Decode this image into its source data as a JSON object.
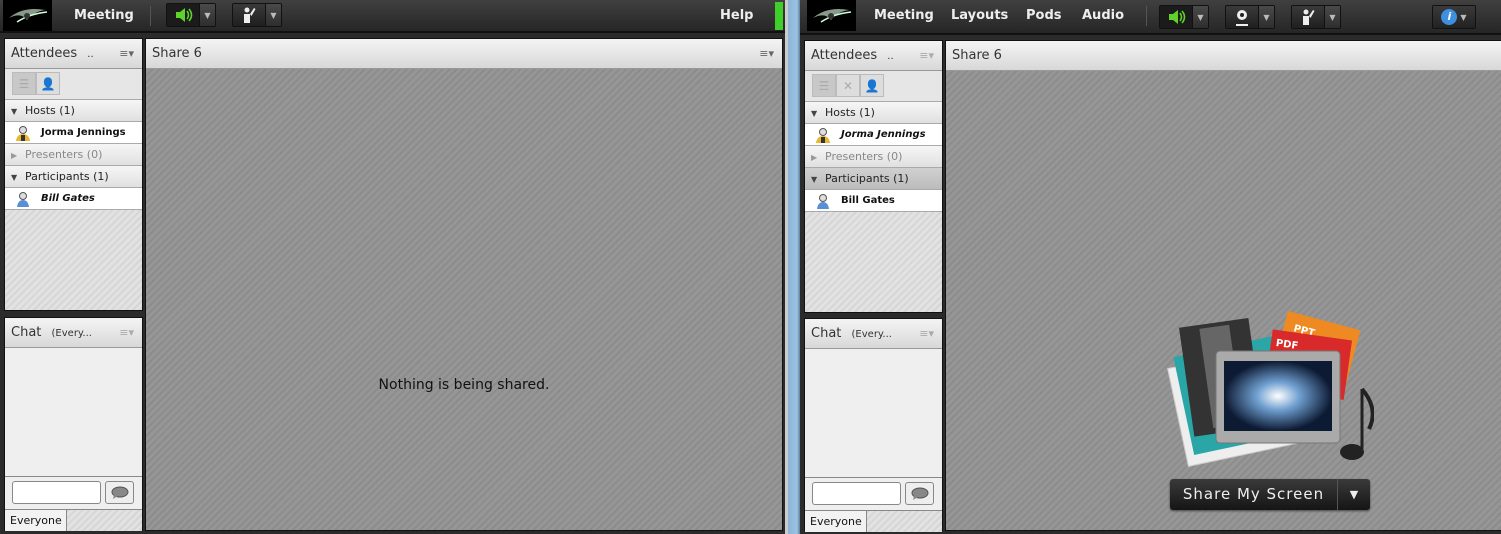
{
  "left_window": {
    "menus": [
      "Meeting",
      "Help"
    ],
    "toolbar": {
      "speaker_icon": "speaker-on-icon",
      "raise_hand_icon": "raise-hand-icon"
    },
    "attendees": {
      "title": "Attendees",
      "title_more": "..",
      "sections": [
        {
          "label": "Hosts (1)",
          "expanded": true,
          "members": [
            {
              "name": "Jorma Jennings",
              "role_icon": "host-icon"
            }
          ]
        },
        {
          "label": "Presenters (0)",
          "expanded": false,
          "members": []
        },
        {
          "label": "Participants (1)",
          "expanded": true,
          "members": [
            {
              "name": "Bill Gates",
              "role_icon": "participant-icon",
              "italic": true
            }
          ]
        }
      ]
    },
    "share": {
      "title": "Share 6",
      "status": "Nothing is being shared."
    },
    "chat": {
      "title": "Chat",
      "scope": "(Every...",
      "tab": "Everyone",
      "input_value": ""
    }
  },
  "right_window": {
    "menus": [
      "Meeting",
      "Layouts",
      "Pods",
      "Audio"
    ],
    "toolbar": {
      "speaker_icon": "speaker-on-icon",
      "webcam_icon": "webcam-icon",
      "raise_hand_icon": "raise-hand-icon",
      "info_icon": "info-icon"
    },
    "attendees": {
      "title": "Attendees",
      "title_more": "..",
      "sections": [
        {
          "label": "Hosts (1)",
          "expanded": true,
          "members": [
            {
              "name": "Jorma Jennings",
              "role_icon": "host-icon",
              "italic": true
            }
          ]
        },
        {
          "label": "Presenters (0)",
          "expanded": false,
          "members": []
        },
        {
          "label": "Participants (1)",
          "expanded": true,
          "members": [
            {
              "name": "Bill Gates",
              "role_icon": "participant-icon"
            }
          ]
        }
      ]
    },
    "share": {
      "title": "Share 6",
      "share_button": "Share My Screen",
      "illustration_labels": [
        "PPT",
        "PDF"
      ]
    },
    "chat": {
      "title": "Chat",
      "scope": "(Every...",
      "tab": "Everyone",
      "input_value": ""
    }
  },
  "colors": {
    "speaker_active": "#5fd22a",
    "info_blue": "#3f8fe0",
    "divider_blue": "#9cc2e2"
  }
}
